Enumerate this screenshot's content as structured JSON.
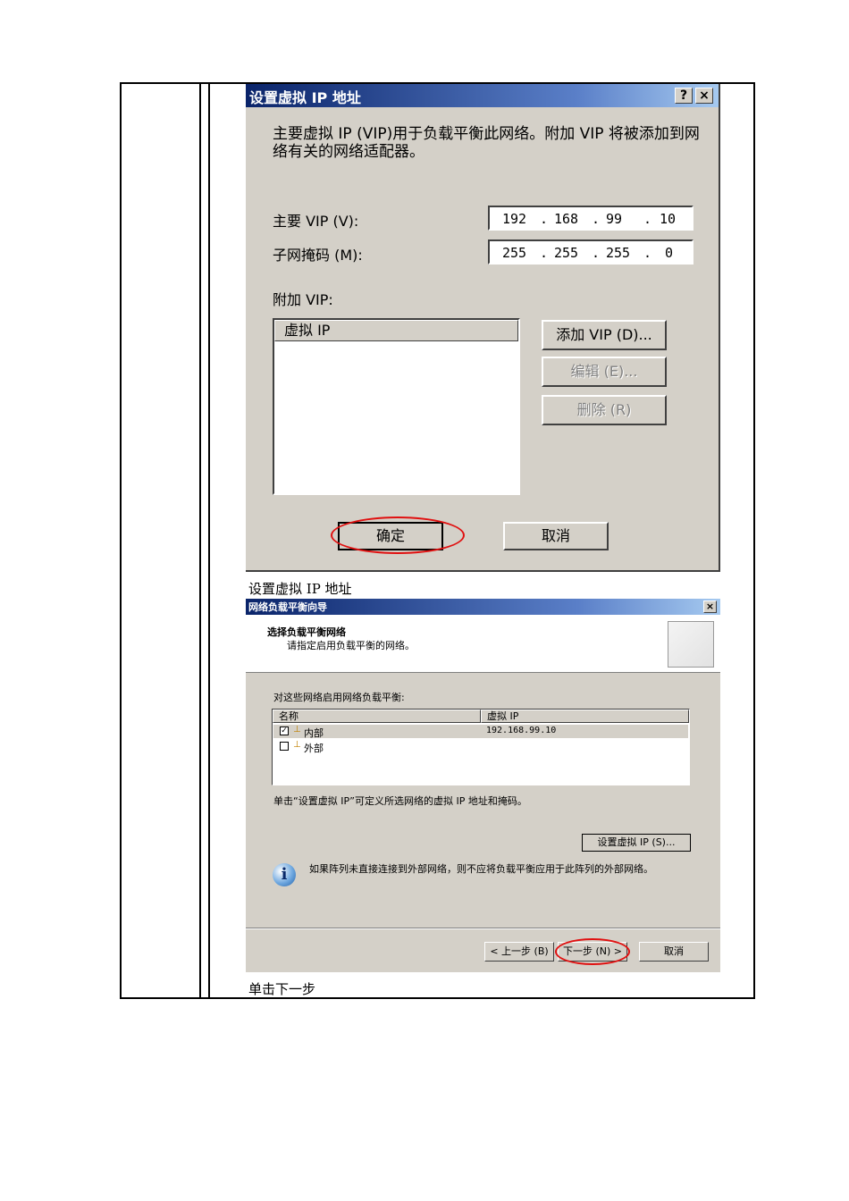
{
  "dialog1": {
    "title": "设置虚拟 IP 地址",
    "help_btn": "?",
    "close_btn": "×",
    "description": "主要虚拟 IP (VIP)用于负载平衡此网络。附加 VIP 将被添加到网络有关的网络适配器。",
    "primary_vip_label": "主要 VIP (V):",
    "primary_vip": [
      "192",
      "168",
      "99",
      "10"
    ],
    "subnet_mask_label": "子网掩码 (M):",
    "subnet_mask": [
      "255",
      "255",
      "255",
      "0"
    ],
    "ip_dot": ".",
    "additional_vip_label": "附加 VIP:",
    "list_header": "虚拟 IP",
    "add_btn": "添加 VIP (D)...",
    "edit_btn": "编辑 (E)...",
    "delete_btn": "删除 (R)",
    "ok_btn": "确定",
    "cancel_btn": "取消"
  },
  "caption1": "设置虚拟 IP 地址",
  "dialog2": {
    "title": "网络负载平衡向导",
    "close_btn": "×",
    "header_title": "选择负载平衡网络",
    "header_subtitle": "请指定启用负载平衡的网络。",
    "instruction": "对这些网络启用网络负载平衡:",
    "columns": [
      "名称",
      "虚拟 IP"
    ],
    "rows": [
      {
        "checked": true,
        "check_mark": "✓",
        "name": "内部",
        "vip": "192.168.99.10"
      },
      {
        "checked": false,
        "check_mark": "",
        "name": "外部",
        "vip": ""
      }
    ],
    "hint": "单击“设置虚拟 IP”可定义所选网络的虚拟 IP 地址和掩码。",
    "set_vip_btn": "设置虚拟 IP (S)...",
    "info_icon_glyph": "i",
    "info_text": "如果阵列未直接连接到外部网络，则不应将负载平衡应用于此阵列的外部网络。",
    "back_btn": "< 上一步 (B)",
    "next_btn": "下一步 (N) >",
    "cancel_btn": "取消"
  },
  "caption2": "单击下一步",
  "colors": {
    "titlebar": "#0a246a",
    "dialog_bg": "#d4d0c8",
    "highlight_ellipse": "#e01010"
  }
}
